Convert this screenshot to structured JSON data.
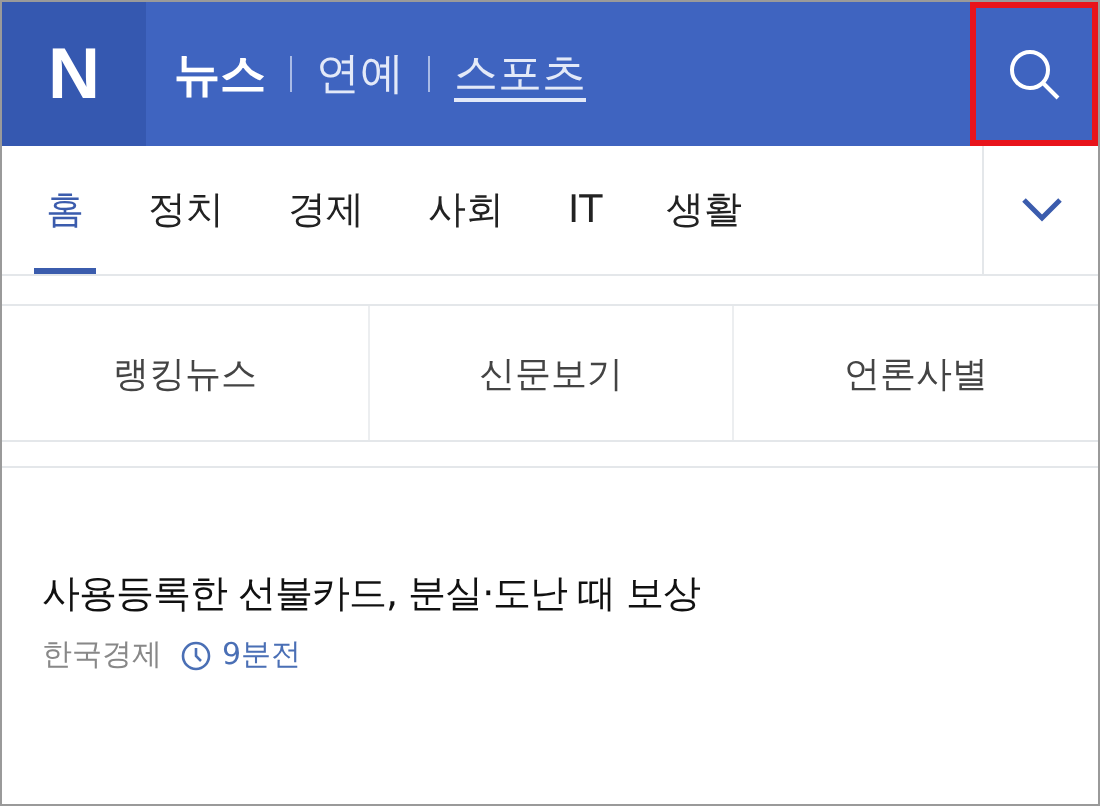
{
  "header": {
    "logo": "N",
    "sections": [
      {
        "label": "뉴스",
        "selected": true,
        "underlined": false
      },
      {
        "label": "연예",
        "selected": false,
        "underlined": false
      },
      {
        "label": "스포츠",
        "selected": false,
        "underlined": true
      }
    ],
    "search": {
      "highlighted": true
    }
  },
  "tabs": [
    {
      "label": "홈",
      "selected": true
    },
    {
      "label": "정치",
      "selected": false
    },
    {
      "label": "경제",
      "selected": false
    },
    {
      "label": "사회",
      "selected": false
    },
    {
      "label": "IT",
      "selected": false
    },
    {
      "label": "생활",
      "selected": false
    }
  ],
  "subnav": [
    "랭킹뉴스",
    "신문보기",
    "언론사별"
  ],
  "articles": [
    {
      "headline": "사용등록한 선불카드, 분실·도난 때 보상",
      "source": "한국경제",
      "time": "9분전"
    }
  ]
}
